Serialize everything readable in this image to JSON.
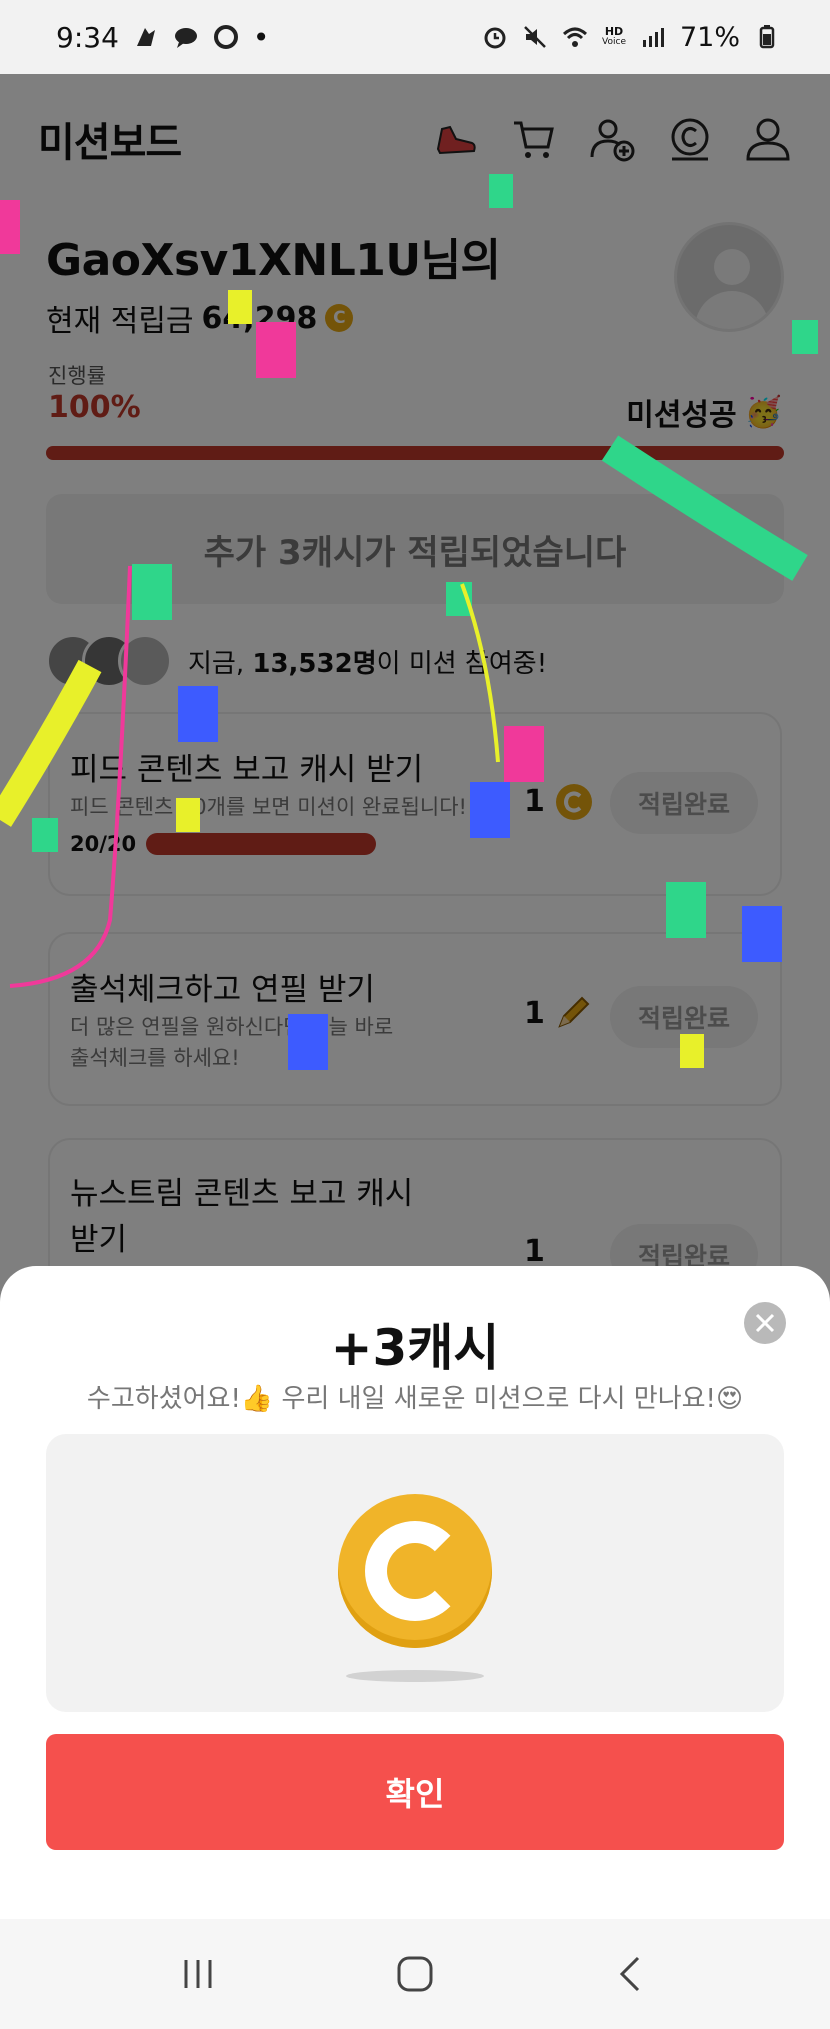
{
  "status_bar": {
    "time": "9:34",
    "dot": "•",
    "network": "HD",
    "network_sub": "Voice",
    "battery": "71%"
  },
  "header": {
    "title": "미션보드",
    "icons": [
      "sneaker-icon",
      "cart-icon",
      "add-friend-icon",
      "cash-coin-icon",
      "profile-icon"
    ]
  },
  "profile": {
    "username": "GaoXsv1XNL1U님의",
    "points_label": "현재 적립금",
    "points_value": "64,298",
    "coin_glyph": "C"
  },
  "progress": {
    "label": "진행률",
    "value": "100%",
    "status": "미션성공",
    "status_emoji": "🥳",
    "fraction": 1.0
  },
  "bonus": {
    "text": "추가 3캐시가 적립되었습니다"
  },
  "participants": {
    "prefix": "지금, ",
    "count": "13,532명",
    "suffix": "이 미션 참여중!"
  },
  "missions": [
    {
      "title": "피드 콘텐츠 보고 캐시 받기",
      "desc": "피드 콘텐츠 20개를 보면 미션이 완료됩니다!",
      "progress_text": "20/20",
      "reward_count": "1",
      "reward_type": "coin",
      "button": "적립완료"
    },
    {
      "title": "출석체크하고 연필 받기",
      "desc_line1": "더 많은 연필을 원하신다면 오늘 바로",
      "desc_line2": "출석체크를 하세요!",
      "reward_count": "1",
      "reward_type": "pencil",
      "button": "적립완료"
    },
    {
      "title_line1": "뉴스트림 콘텐츠 보고 캐시",
      "title_line2": "받기",
      "reward_count": "1",
      "button": "적립완료"
    }
  ],
  "sheet": {
    "title": "+3캐시",
    "message": "수고하셨어요!👍 우리 내일 새로운 미션으로 다시 만나요!😍",
    "confirm": "확인"
  },
  "colors": {
    "accent_red": "#c0392b",
    "confirm": "#f5504d",
    "coin": "#f0b429"
  }
}
